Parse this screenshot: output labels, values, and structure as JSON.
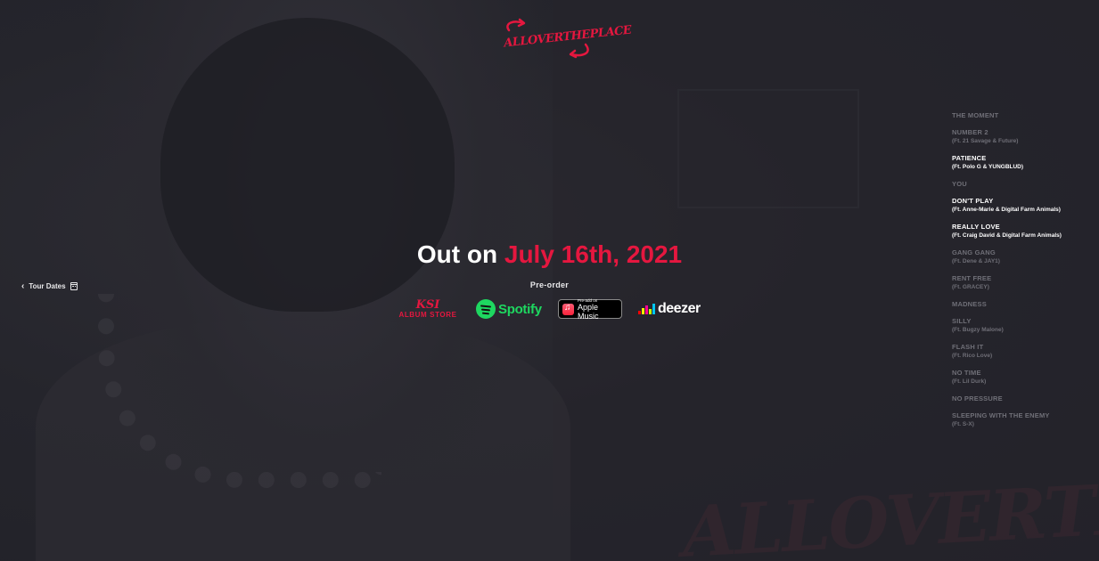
{
  "logo": {
    "text": "ALLOVERTHEPLACE"
  },
  "release": {
    "prefix": "Out on",
    "date": "July 16th, 2021",
    "preorder_label": "Pre-order"
  },
  "stores": {
    "ksi": {
      "logo": "KSI",
      "sub": "ALBUM STORE"
    },
    "spotify": {
      "label": "Spotify"
    },
    "apple": {
      "small": "Pre-add on",
      "big": "Apple Music"
    },
    "deezer": {
      "label": "deezer"
    }
  },
  "tour": {
    "label": "Tour Dates"
  },
  "tracklist": [
    {
      "title": "THE MOMENT",
      "feat": "",
      "highlighted": false
    },
    {
      "title": "NUMBER 2",
      "feat": "(Ft. 21 Savage & Future)",
      "highlighted": false
    },
    {
      "title": "PATIENCE",
      "feat": "(Ft. Polo G & YUNGBLUD)",
      "highlighted": true
    },
    {
      "title": "YOU",
      "feat": "",
      "highlighted": false
    },
    {
      "title": "DON'T PLAY",
      "feat": "(Ft. Anne-Marie & Digital Farm Animals)",
      "highlighted": true
    },
    {
      "title": "REALLY LOVE",
      "feat": "(Ft. Craig David & Digital Farm Animals)",
      "highlighted": true
    },
    {
      "title": "GANG GANG",
      "feat": "(Ft. Dene & JAY1)",
      "highlighted": false
    },
    {
      "title": "RENT FREE",
      "feat": "(Ft. GRACEY)",
      "highlighted": false
    },
    {
      "title": "MADNESS",
      "feat": "",
      "highlighted": false
    },
    {
      "title": "SILLY",
      "feat": "(Ft. Bugzy Malone)",
      "highlighted": false
    },
    {
      "title": "FLASH IT",
      "feat": "(Ft. Rico Love)",
      "highlighted": false
    },
    {
      "title": "NO TIME",
      "feat": "(Ft. Lil Durk)",
      "highlighted": false
    },
    {
      "title": "NO PRESSURE",
      "feat": "",
      "highlighted": false
    },
    {
      "title": "SLEEPING WITH THE ENEMY",
      "feat": "(Ft. S-X)",
      "highlighted": false
    }
  ],
  "colors": {
    "accent": "#e5173f",
    "background": "#23232a",
    "spotify": "#1ed760",
    "deezer_bars": [
      "#ff0000",
      "#ffed00",
      "#ff0092",
      "#c2ff00",
      "#00c7f2"
    ]
  },
  "icons": {
    "tour_chevron": "chevron-left-icon",
    "tour_calendar": "calendar-icon",
    "spotify": "spotify-icon",
    "apple_music": "apple-music-icon",
    "deezer": "deezer-bars-icon"
  }
}
